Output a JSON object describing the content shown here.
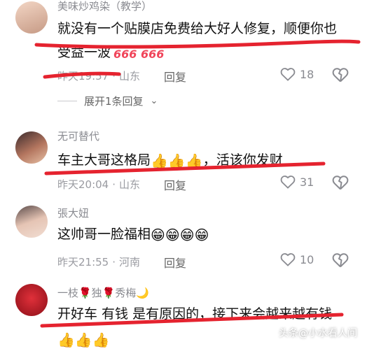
{
  "colors": {
    "annotation_red": "#e5232f",
    "meta_gray": "#9a9ba1",
    "text_dark": "#111111"
  },
  "comments": [
    {
      "username": "美味炒鸡染（教学）",
      "text_line1": "就没有一个贴膜店免费给大好人修复，顺便你也",
      "text_line2": "受益一波",
      "text_emoji": "666 666",
      "time": "昨天19:57",
      "location": "山东",
      "reply_label": "回复",
      "likes": "18",
      "expand_label": "展开1条回复"
    },
    {
      "username": "无可替代",
      "text": "车主大哥这格局",
      "text_emoji": "👍👍👍",
      "text_tail": "，活该你发财",
      "time": "昨天20:04",
      "location": "山东",
      "reply_label": "回复",
      "likes": "31"
    },
    {
      "username": "張大妞",
      "text": "这帅哥一脸福相",
      "text_emoji": "😁😁😁😁",
      "time": "昨天21:55",
      "location": "河南",
      "reply_label": "回复",
      "likes": "10"
    },
    {
      "username": "一枝🌹独🌹秀梅🌙",
      "text": "开好车 有钱 是有原因的，接下来会越来越有钱",
      "text_emoji": "👍👍👍"
    }
  ],
  "watermark": "头条@小水看人间"
}
